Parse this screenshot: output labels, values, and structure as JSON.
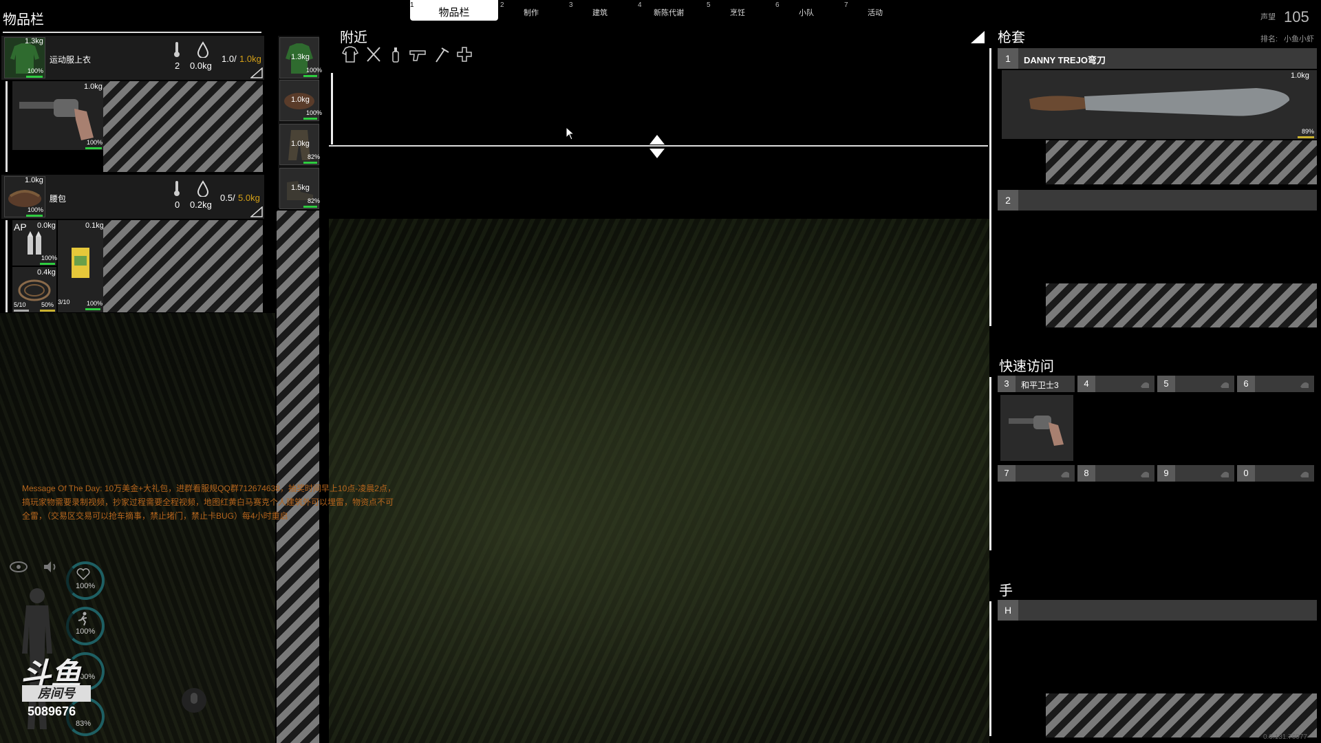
{
  "colors": {
    "accent": "#2ecc40",
    "weight_limit": "#d4a017",
    "motd": "#b5651d",
    "ring": "#1e5f63"
  },
  "tabs": [
    {
      "num": "1",
      "label": "物品栏",
      "active": true
    },
    {
      "num": "2",
      "label": "制作"
    },
    {
      "num": "3",
      "label": "建筑"
    },
    {
      "num": "4",
      "label": "新陈代谢"
    },
    {
      "num": "5",
      "label": "烹饪"
    },
    {
      "num": "6",
      "label": "小队"
    },
    {
      "num": "7",
      "label": "活动"
    }
  ],
  "top_right": {
    "fame_label": "声望",
    "fame_value": "105",
    "rank_label": "排名:",
    "rank_value": "小鱼小虾"
  },
  "inventory": {
    "title": "物品栏",
    "jacket": {
      "weight": "1.3kg",
      "name": "运动服上衣",
      "pct": "100%",
      "temp": "2",
      "wet": "0.0kg",
      "cap_used": "1.0/",
      "cap_max": "1.0kg"
    },
    "revolver": {
      "weight": "1.0kg",
      "pct": "100%"
    },
    "bag": {
      "weight": "1.0kg",
      "name": "腰包",
      "pct": "100%",
      "temp": "0",
      "wet": "0.2kg",
      "cap_used": "0.5/",
      "cap_max": "5.0kg"
    },
    "ammo": {
      "badge": "AP",
      "weight": "0.0kg",
      "pct": "100%"
    },
    "rope": {
      "weight": "0.4kg",
      "count_a": "5/10",
      "pct_a": "50%",
      "count_b": "3/10"
    },
    "box": {
      "weight": "0.1kg",
      "pct": "100%"
    }
  },
  "equipment_column": [
    {
      "icon": "jacket-icon",
      "weight": "1.3kg",
      "pct": "100%"
    },
    {
      "icon": "belt-icon",
      "weight": "1.0kg",
      "pct": "100%"
    },
    {
      "icon": "pants-icon",
      "weight": "1.0kg",
      "pct": "82%"
    },
    {
      "icon": "shoes-icon",
      "weight": "1.5kg",
      "pct": "82%"
    }
  ],
  "nearby": {
    "title": "附近",
    "filters": [
      "clothing-icon",
      "tools-icon",
      "bottle-icon",
      "gun-icon",
      "hammer-icon",
      "medical-icon"
    ]
  },
  "holster": {
    "title": "枪套",
    "slot1": {
      "num": "1",
      "label": "DANNY TREJO弯刀",
      "weight": "1.0kg",
      "pct": "89%"
    },
    "slot2": {
      "num": "2",
      "label": ""
    }
  },
  "quick_access": {
    "title": "快速访问",
    "slots": [
      {
        "num": "3",
        "label": "和平卫士3"
      },
      {
        "num": "4",
        "label": ""
      },
      {
        "num": "5",
        "label": ""
      },
      {
        "num": "6",
        "label": ""
      },
      {
        "num": "7",
        "label": ""
      },
      {
        "num": "8",
        "label": ""
      },
      {
        "num": "9",
        "label": ""
      },
      {
        "num": "0",
        "label": ""
      }
    ]
  },
  "hands": {
    "title": "手",
    "slot": {
      "num": "H",
      "label": ""
    }
  },
  "motd": "Message Of The Day: 10万美金+大礼包，进群看服规QQ群712674638，抽奖时间早上10点-凌晨2点，搞玩家物需要录制视频，抄家过程需要全程视频，地图红黄白马赛克个人建筑外可以埋雷，物资点不可全雷，（交易区交易可以抢车摘事，禁止堵门，禁止卡BUG）每4小时重启",
  "vitals": [
    {
      "icon": "heart-icon",
      "value": "100%"
    },
    {
      "icon": "stamina-icon",
      "value": "100%"
    },
    {
      "icon": "food-icon",
      "value": "100%"
    },
    {
      "icon": "water-icon",
      "value": "83%"
    }
  ],
  "watermark": {
    "logo": "斗鱼",
    "room_label": "房间号",
    "room_number": "5089676"
  },
  "version": "0.9.131.76977"
}
